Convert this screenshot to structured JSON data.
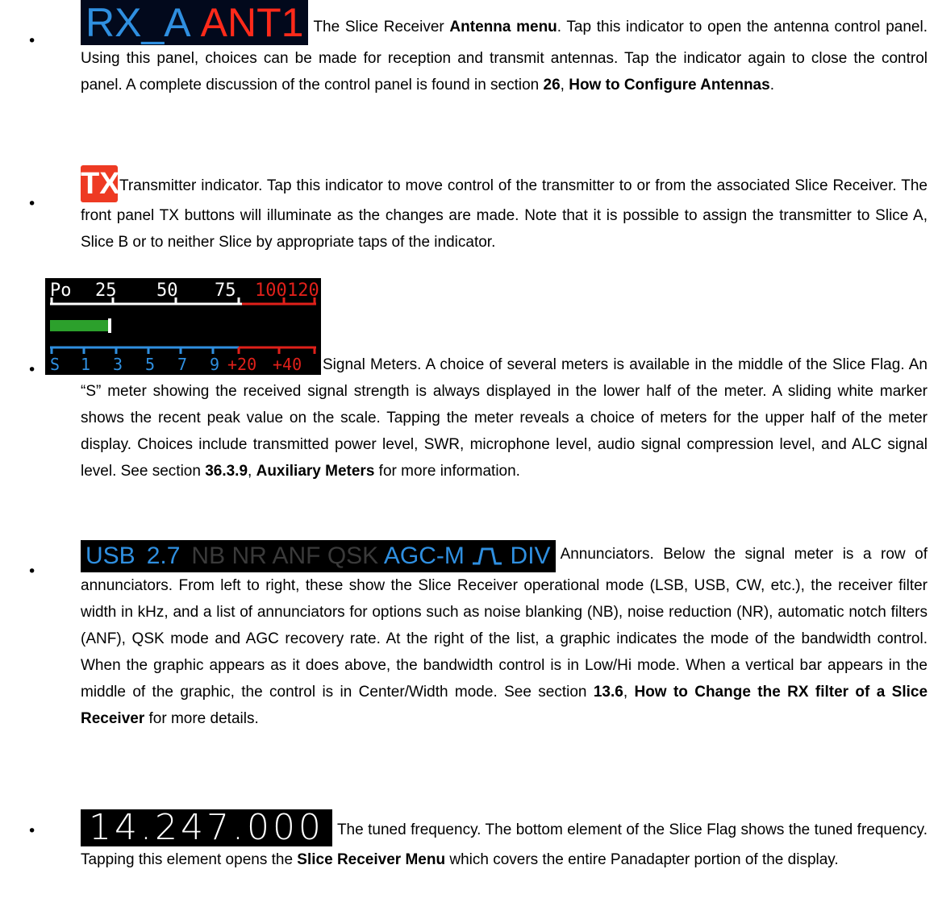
{
  "items": [
    {
      "image": {
        "rx": "RX_A",
        "ant": "ANT1"
      },
      "lead": "The Slice Receiver ",
      "bold1": "Antenna menu",
      "rest1": ".  Tap this indicator to open the antenna control panel.  Using this panel, choices can be made for reception and transmit antennas.  Tap the indicator again to close the control panel.  A complete discussion of the control panel is found in section ",
      "bold2": "26",
      "sep": ", ",
      "bold3": "How to Configure Antennas",
      "end": "."
    },
    {
      "image": {
        "label": "TX"
      },
      "text": "Transmitter indicator.  Tap this indicator to move control of the transmitter to or from the associated Slice Receiver.  The front panel TX buttons will illuminate as the changes are made.  Note that it is possible to assign the transmitter to Slice A, Slice B or to neither Slice by appropriate taps of the indicator."
    },
    {
      "meter": {
        "upper_labels": [
          "Po",
          "25",
          "50",
          "75",
          "100",
          "120"
        ],
        "lower_labels": [
          "S",
          "1",
          "3",
          "5",
          "7",
          "9",
          "+20",
          "+40"
        ],
        "signal_level": 0.22
      },
      "text1": "Signal Meters.  A choice of several meters is available in the middle of the Slice Flag.  An “S” meter showing the received signal strength is always displayed in the lower half of the meter.  A sliding white marker shows the recent peak value on the scale.  Tapping the meter reveals a choice of meters for the upper half of the meter display.  Choices include transmitted power level, SWR, microphone level, audio signal compression level, and ALC signal level.  See section ",
      "bold1": "36.3.9",
      "sep": ", ",
      "bold2": "Auxiliary Meters",
      "end": " for more information."
    },
    {
      "annunciators": {
        "mode": "USB",
        "width": "2.7",
        "dim": [
          "NB",
          "NR",
          "ANF",
          "QSK"
        ],
        "agc": "AGC-M",
        "div": "DIV"
      },
      "text1": "Annunciators.  Below the signal meter is a row of annunciators.  From left to right, these show the Slice Receiver operational mode (LSB, USB, CW, etc.), the receiver filter width in kHz, and a list of annunciators for options such as noise blanking (NB), noise reduction (NR), automatic notch filters (ANF), QSK mode and AGC recovery rate.  At the right of the list, a graphic indicates the mode of the bandwidth control.  When the graphic appears as it does above, the bandwidth control is in Low/Hi mode.  When a vertical bar appears in the middle of the graphic, the control is in Center/Width mode.  See section ",
      "bold1": "13.6",
      "sep": ", ",
      "bold2": "How to Change the RX filter of a Slice Receiver",
      "end": " for more details."
    },
    {
      "frequency": "14.247.000",
      "text1": "The tuned frequency.  The bottom element of the Slice Flag shows the tuned frequency.  Tapping this element opens the ",
      "bold1": "Slice Receiver Menu",
      "end": " which covers the entire Panadapter portion of the display."
    }
  ],
  "colors": {
    "rx_blue": "#2f8fe0",
    "ant_red": "#ff2a1a",
    "tx_red": "#ee3a23",
    "meter_green": "#2ca02c",
    "meter_red": "#e0201a"
  }
}
